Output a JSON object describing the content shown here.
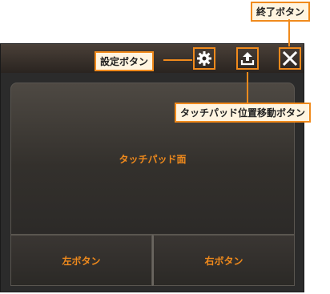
{
  "callouts": {
    "exit": "終了ボタン",
    "settings": "設定ボタン",
    "move": "タッチパッド位置移動ボタン"
  },
  "touchpad": {
    "label": "タッチパッド面"
  },
  "buttons": {
    "left": "左ボタン",
    "right": "右ボタン"
  },
  "icons": {
    "settings": "gear-icon",
    "move": "upload-icon",
    "exit": "close-icon"
  },
  "colors": {
    "accent": "#f08a1c",
    "window": "#2b2b2b"
  }
}
